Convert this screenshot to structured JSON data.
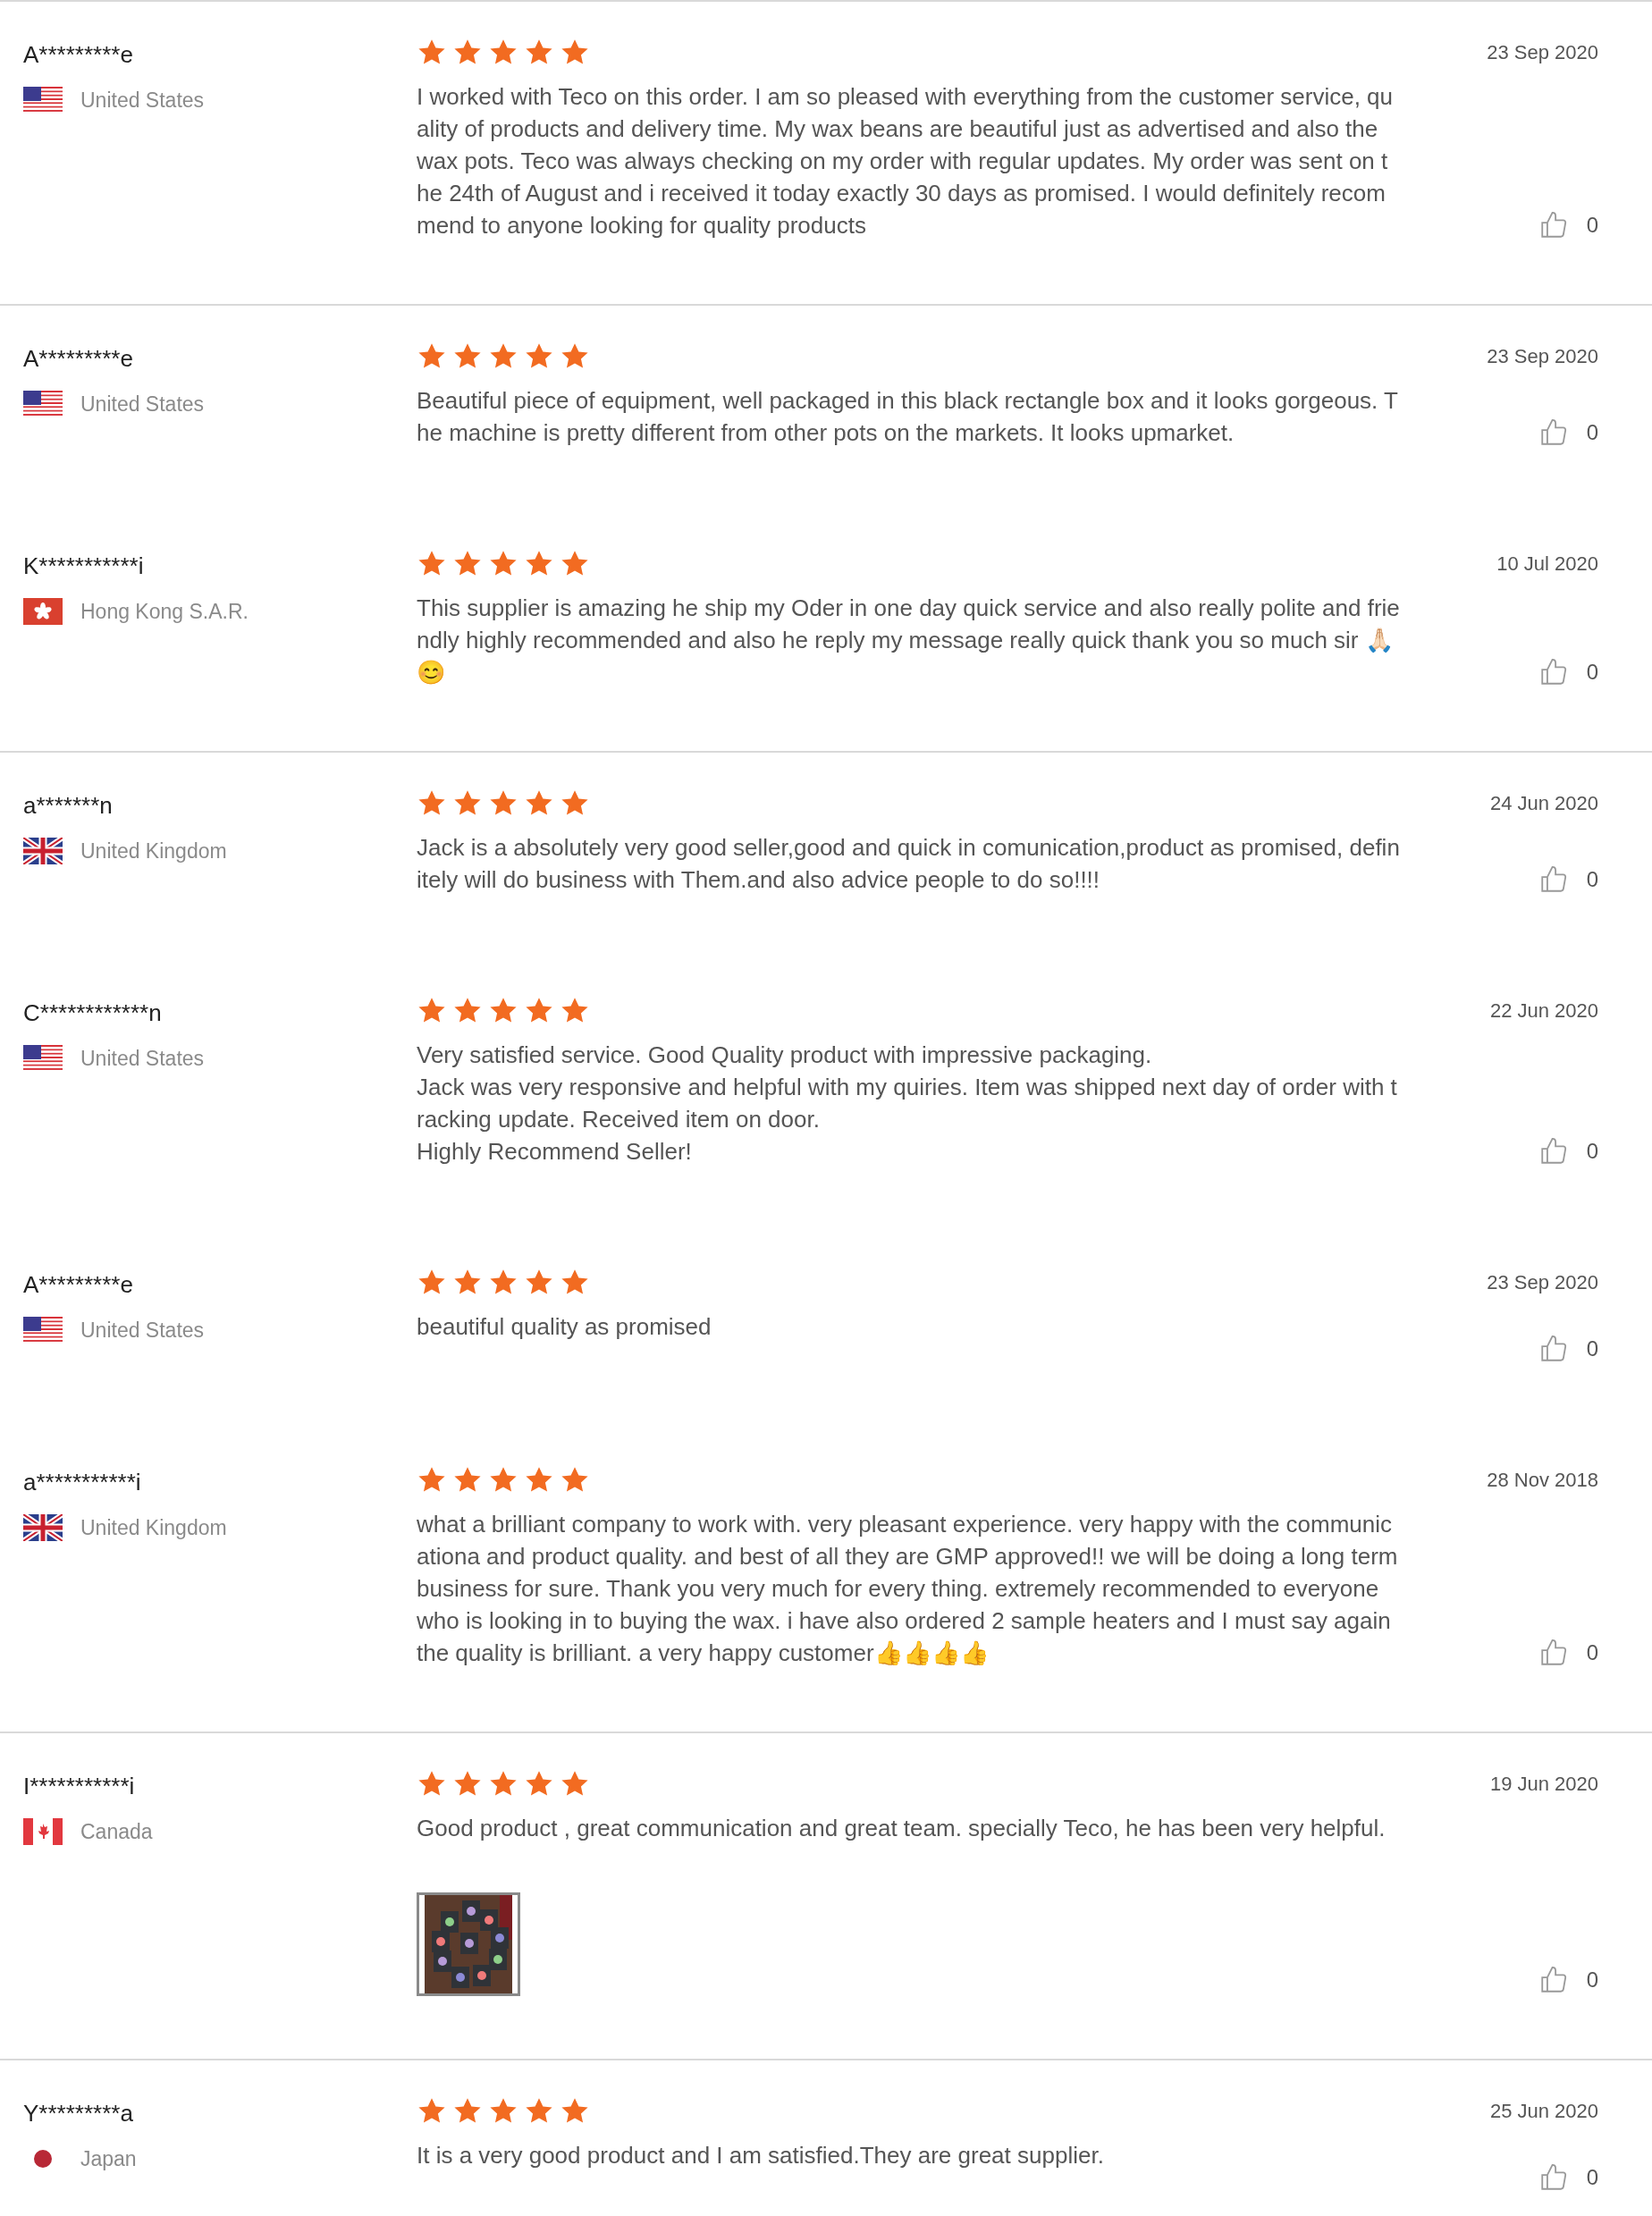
{
  "reviews": [
    {
      "name": "A*********e",
      "country": "United States",
      "kind": "us",
      "stars": 5,
      "date": "23 Sep 2020",
      "likes": "0",
      "divided": true,
      "text": "I worked with Teco on this order. I am so pleased with everything from the customer service, quality of products and delivery time. My wax beans are beautiful just as advertised and also the wax pots. Teco was always checking on my order with regular updates. My order was sent on the 24th of August and i received it today exactly 30 days as promised. I would definitely recommend to anyone looking for quality products"
    },
    {
      "name": "A*********e",
      "country": "United States",
      "kind": "us",
      "stars": 5,
      "date": "23 Sep 2020",
      "likes": "0",
      "divided": true,
      "text": "Beautiful piece of equipment, well packaged in this black rectangle box and it looks gorgeous. The machine is pretty different from other pots on the markets. It looks upmarket."
    },
    {
      "name": "K***********i",
      "country": "Hong Kong S.A.R.",
      "kind": "hk",
      "stars": 5,
      "date": "10 Jul 2020",
      "likes": "0",
      "divided": false,
      "text": "This supplier is amazing he ship my Oder in one day quick service and also really polite and friendly highly recommended and also he reply my message really quick thank you so much sir 🙏🏻😊"
    },
    {
      "name": "a*******n",
      "country": "United Kingdom",
      "kind": "gb",
      "stars": 5,
      "date": "24 Jun 2020",
      "likes": "0",
      "divided": true,
      "text": "Jack is a absolutely very good seller,good and quick in comunication,product as promised, definitely will do business with Them.and also advice people to do so!!!!"
    },
    {
      "name": "C************n",
      "country": "United States",
      "kind": "us",
      "stars": 5,
      "date": "22 Jun 2020",
      "likes": "0",
      "divided": false,
      "text": "Very satisfied service. Good Quality product  with impressive packaging.\nJack was very responsive and helpful with my quiries. Item was shipped next day of order with tracking update. Received item on door.\nHighly Recommend Seller!"
    },
    {
      "name": "A*********e",
      "country": "United States",
      "kind": "us",
      "stars": 5,
      "date": "23 Sep 2020",
      "likes": "0",
      "divided": false,
      "text": "beautiful quality as promised"
    },
    {
      "name": "a***********i",
      "country": "United Kingdom",
      "kind": "gb",
      "stars": 5,
      "date": "28 Nov 2018",
      "likes": "0",
      "divided": false,
      "text": "what a brilliant company to work with. very pleasant experience. very happy with the communicationa and product quality. and best of all they are GMP approved!! we will be doing a long term business for sure. Thank you very much for every thing. extremely recommended to everyone who is looking in to buying the wax. i have also ordered 2 sample heaters and I must say again the quality is brilliant. a very happy customer👍👍👍👍"
    },
    {
      "name": "I***********i",
      "country": "Canada",
      "kind": "ca",
      "stars": 5,
      "date": "19 Jun 2020",
      "likes": "0",
      "divided": true,
      "text": "Good product , great communication and great team. specially Teco, he has been very helpful.",
      "photos": [
        {
          "kind": "picture"
        }
      ]
    },
    {
      "name": "Y*********a",
      "country": "Japan",
      "kind": "jp",
      "stars": 5,
      "date": "25 Jun 2020",
      "likes": "0",
      "divided": true,
      "text": "It is a very good product and I am satisfied.They are great supplier."
    }
  ]
}
